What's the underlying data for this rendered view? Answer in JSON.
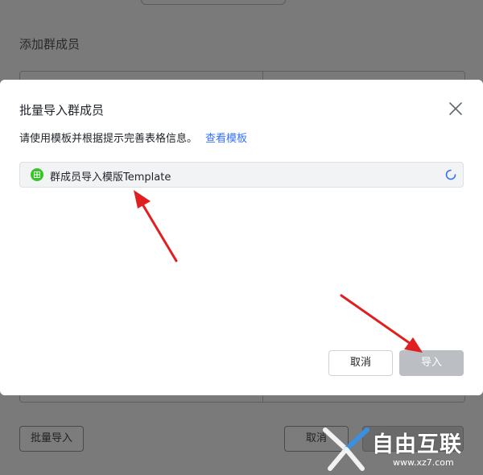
{
  "background_dialog": {
    "title": "添加群成员",
    "batch_import_label": "批量导入",
    "cancel_label": "取消"
  },
  "modal": {
    "title": "批量导入群成员",
    "hint_text": "请使用模板并根据提示完善表格信息。",
    "hint_link": "查看模板",
    "file_name": "群成员导入模版Template",
    "cancel_label": "取消",
    "import_label": "导入"
  },
  "watermark": {
    "text": "自由互联",
    "url": "www.xz7.com"
  },
  "colors": {
    "link": "#3370ff",
    "sheet_icon": "#34c724",
    "spinner": "#3370ff",
    "import_disabled": "#bbbfc4",
    "arrow": "#e02020"
  },
  "icons": [
    "close-icon",
    "spreadsheet-icon",
    "loading-spinner-icon"
  ]
}
